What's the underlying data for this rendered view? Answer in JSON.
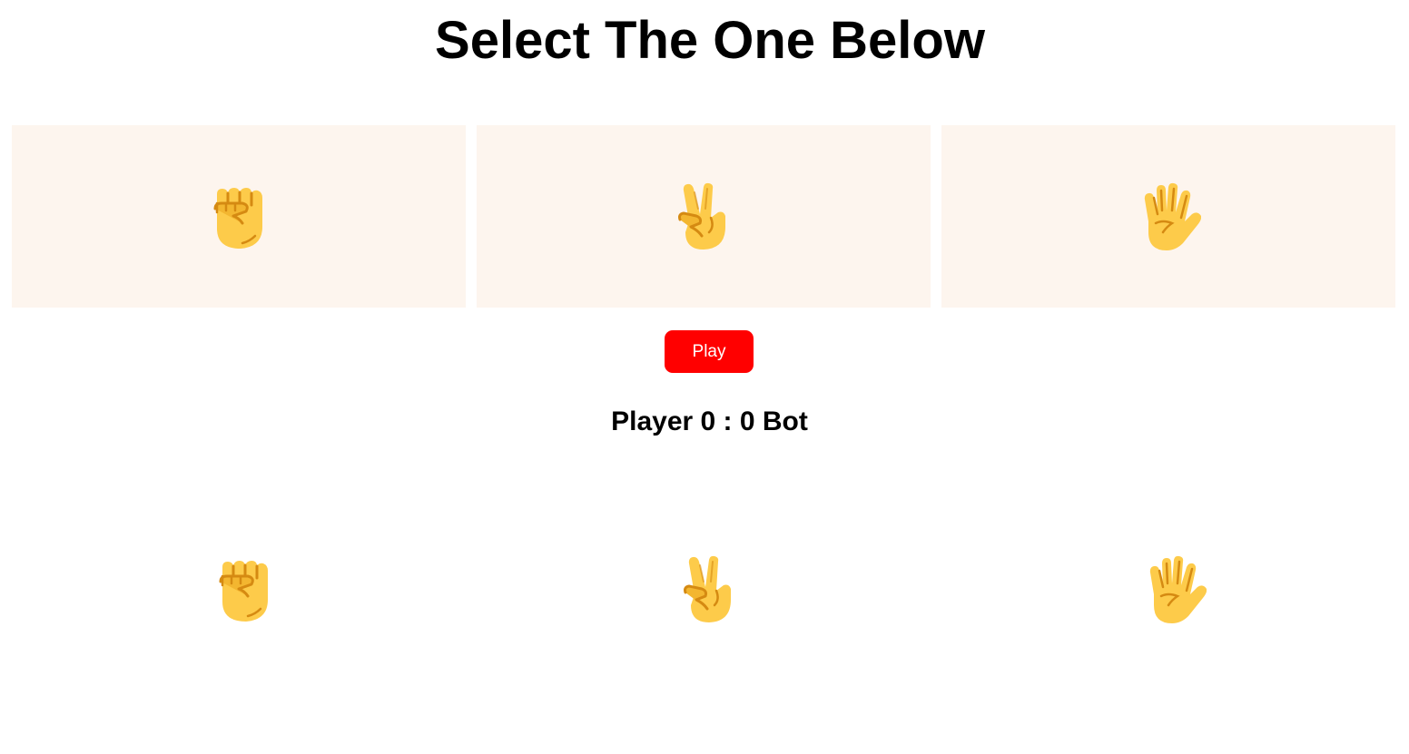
{
  "page": {
    "title": "Select The One Below"
  },
  "choices": [
    {
      "name": "rock",
      "icon": "raised-fist-icon"
    },
    {
      "name": "scissors",
      "icon": "victory-hand-icon"
    },
    {
      "name": "paper",
      "icon": "raised-hand-icon"
    }
  ],
  "play_button": {
    "label": "Play"
  },
  "score": {
    "text": "Player 0 : 0 Bot",
    "player": 0,
    "bot": 0
  },
  "bot_choices": [
    {
      "name": "rock",
      "icon": "raised-fist-icon"
    },
    {
      "name": "scissors",
      "icon": "victory-hand-icon"
    },
    {
      "name": "paper",
      "icon": "raised-hand-icon"
    }
  ],
  "colors": {
    "card_background": "#fdf5ee",
    "play_button_background": "#ff0000",
    "play_button_text": "#ffffff",
    "emoji_fill": "#fdcb4a",
    "emoji_line": "#d58a12"
  }
}
